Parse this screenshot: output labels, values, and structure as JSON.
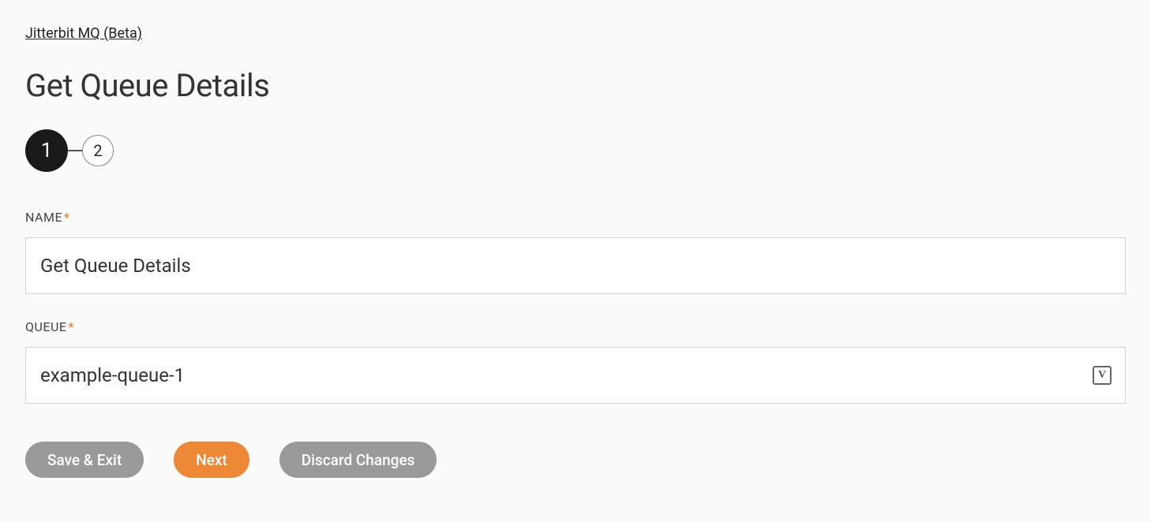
{
  "breadcrumb": {
    "label": "Jitterbit MQ (Beta)"
  },
  "header": {
    "title": "Get Queue Details"
  },
  "stepper": {
    "steps": [
      {
        "number": "1",
        "active": true
      },
      {
        "number": "2",
        "active": false
      }
    ]
  },
  "form": {
    "name": {
      "label": "NAME",
      "required": "*",
      "value": "Get Queue Details"
    },
    "queue": {
      "label": "QUEUE",
      "required": "*",
      "value": "example-queue-1",
      "icon_label": "V"
    }
  },
  "buttons": {
    "save_exit": "Save & Exit",
    "next": "Next",
    "discard": "Discard Changes"
  }
}
